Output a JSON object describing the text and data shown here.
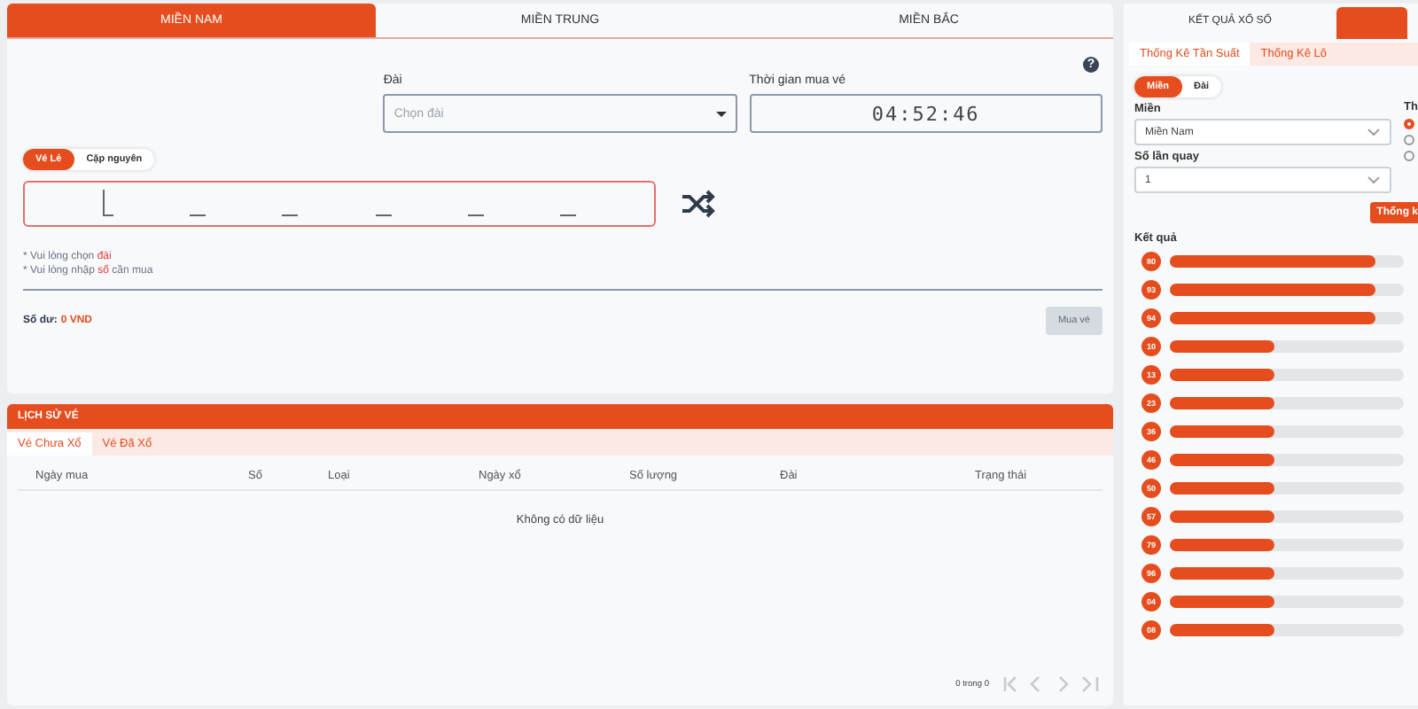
{
  "region_tabs": [
    {
      "label": "MIỀN NAM",
      "selected": true
    },
    {
      "label": "MIỀN TRUNG",
      "selected": false
    },
    {
      "label": "MIỀN BẮC",
      "selected": false
    }
  ],
  "ticket_form": {
    "station": {
      "label": "Đài",
      "placeholder": "Chọn đài"
    },
    "time": {
      "label": "Thời gian mua vé",
      "value": "04:52:46"
    },
    "help": "?",
    "ticket_types": [
      {
        "label": "Vé Lẻ",
        "selected": true
      },
      {
        "label": "Cặp nguyên",
        "selected": false
      }
    ],
    "digit_slots": [
      {
        "active": true
      },
      {
        "active": false
      },
      {
        "active": false
      },
      {
        "active": false
      },
      {
        "active": false
      },
      {
        "active": false
      }
    ],
    "notes": [
      "* Vui lòng chọn **đài**",
      "* Vui lòng nhập **số** cần mua"
    ],
    "balance": {
      "label": "Số dư:",
      "value": "0 VND"
    },
    "buy_button": {
      "label": "Mua vé",
      "disabled": true
    }
  },
  "history": {
    "title": "LỊCH SỬ VÉ",
    "tabs": [
      {
        "label": "Vé Chưa Xổ",
        "selected": true
      },
      {
        "label": "Vé Đã Xổ",
        "selected": false
      }
    ],
    "columns": [
      "Ngày mua",
      "Số",
      "Loại",
      "Ngày xổ",
      "Số lượng",
      "Đài",
      "Trạng thái"
    ],
    "empty": "Không có dữ liệu",
    "pagination": "0 trong 0"
  },
  "results_panel": {
    "tabs": [
      {
        "label": "KẾT QUẢ XỔ SỐ",
        "selected": false
      },
      {
        "selected": true
      }
    ],
    "stat_tabs": [
      {
        "label": "Thống Kê Tần Suất",
        "selected": true
      },
      {
        "label": "Thống Kê Lô",
        "selected": false
      }
    ],
    "mode": [
      {
        "label": "Miền",
        "selected": true
      },
      {
        "label": "Đài",
        "selected": false
      }
    ],
    "region": {
      "label": "Miền",
      "value": "Miền Nam"
    },
    "draws": {
      "label": "Số lần quay",
      "value": "1"
    },
    "cut_label": "Th",
    "radios": [
      {
        "selected": true
      },
      {
        "selected": false
      },
      {
        "selected": false
      }
    ],
    "stat_button": "Thống k",
    "results_label": "Kết quả",
    "results": [
      {
        "number": "80",
        "level": 0.88
      },
      {
        "number": "93",
        "level": 0.88
      },
      {
        "number": "94",
        "level": 0.88
      },
      {
        "number": "10",
        "level": 0.45
      },
      {
        "number": "13",
        "level": 0.45
      },
      {
        "number": "23",
        "level": 0.45
      },
      {
        "number": "36",
        "level": 0.45
      },
      {
        "number": "46",
        "level": 0.45
      },
      {
        "number": "50",
        "level": 0.45
      },
      {
        "number": "57",
        "level": 0.45
      },
      {
        "number": "79",
        "level": 0.45
      },
      {
        "number": "96",
        "level": 0.45
      },
      {
        "number": "04",
        "level": 0.45
      },
      {
        "number": "08",
        "level": 0.45
      }
    ]
  }
}
